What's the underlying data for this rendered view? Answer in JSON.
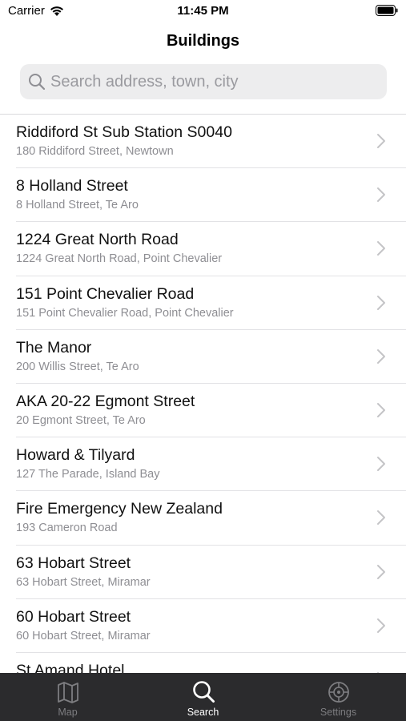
{
  "status_bar": {
    "carrier": "Carrier",
    "time": "11:45 PM"
  },
  "nav": {
    "title": "Buildings"
  },
  "search": {
    "placeholder": "Search address, town, city",
    "value": ""
  },
  "list": {
    "items": [
      {
        "title": "Riddiford St Sub Station S0040",
        "subtitle": "180 Riddiford Street, Newtown"
      },
      {
        "title": "8 Holland Street",
        "subtitle": "8 Holland Street, Te Aro"
      },
      {
        "title": "1224 Great North Road",
        "subtitle": "1224 Great North Road, Point Chevalier"
      },
      {
        "title": "151 Point Chevalier Road",
        "subtitle": "151 Point Chevalier Road, Point Chevalier"
      },
      {
        "title": "The Manor",
        "subtitle": "200 Willis Street, Te Aro"
      },
      {
        "title": "AKA 20-22 Egmont Street",
        "subtitle": "20 Egmont Street, Te Aro"
      },
      {
        "title": "Howard & Tilyard",
        "subtitle": "127 The Parade, Island Bay"
      },
      {
        "title": "Fire Emergency New Zealand",
        "subtitle": "193 Cameron Road"
      },
      {
        "title": "63 Hobart Street",
        "subtitle": "63 Hobart Street, Miramar"
      },
      {
        "title": "60 Hobart Street",
        "subtitle": "60 Hobart Street, Miramar"
      },
      {
        "title": "St Amand Hotel",
        "subtitle": ""
      }
    ]
  },
  "tab_bar": {
    "tabs": [
      {
        "label": "Map",
        "icon": "map-icon",
        "active": false
      },
      {
        "label": "Search",
        "icon": "search-icon",
        "active": true
      },
      {
        "label": "Settings",
        "icon": "settings-icon",
        "active": false
      }
    ]
  },
  "colors": {
    "tab_bar_bg": "#2b2b2d",
    "tab_active": "#ffffff",
    "tab_inactive": "#7d7d80",
    "subtitle": "#8e8e93",
    "search_bg": "#ededee"
  }
}
